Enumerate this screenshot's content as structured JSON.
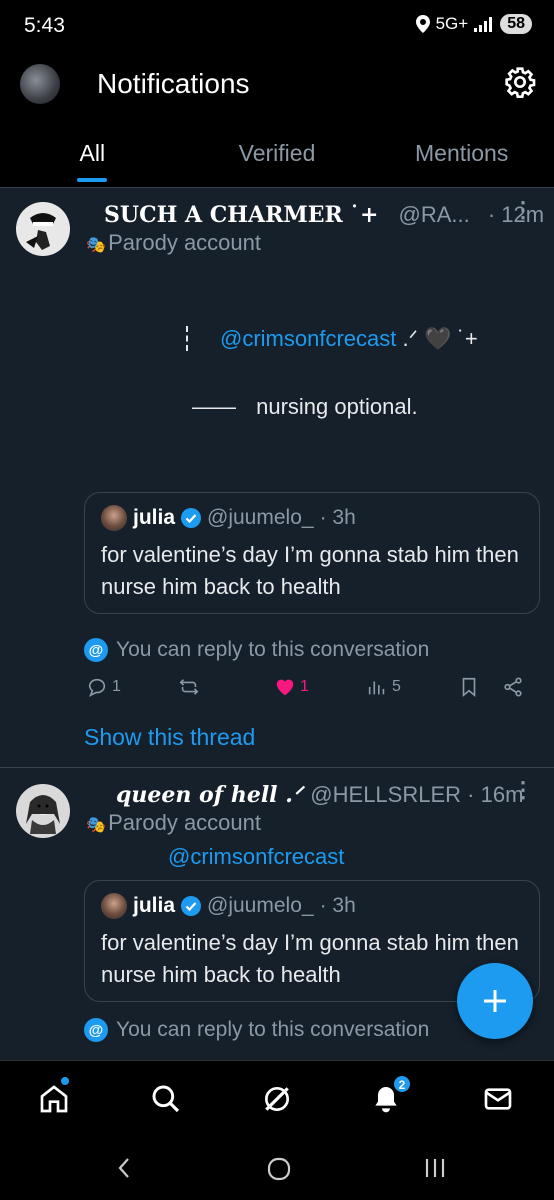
{
  "status": {
    "time": "5:43",
    "network": "5G+",
    "battery": "58"
  },
  "header": {
    "title": "Notifications"
  },
  "tabs": [
    {
      "label": "All",
      "active": true
    },
    {
      "label": "Verified",
      "active": false
    },
    {
      "label": "Mentions",
      "active": false
    }
  ],
  "posts": [
    {
      "display_name": "SUCH A CHARMER",
      "name_suffix": "˙+",
      "handle": "@RA...",
      "time": "· 12m",
      "parody_label": "Parody account",
      "body_line1_mention": "@crimsonfcrecast",
      "body_line1_suffix": ".ᐟ 🖤  ˙+",
      "body_line2_dash": "——",
      "body_line2_text": "nursing   optional.",
      "quote": {
        "name": "julia",
        "handle": "@juumelo_",
        "time": "· 3h",
        "text": "for valentine’s day I’m gonna stab him then nurse him back to health"
      },
      "reply_note": "You can reply to this conversation",
      "actions": {
        "replies": "1",
        "likes": "1",
        "views": "5"
      },
      "show_thread": "Show this thread"
    },
    {
      "display_name": "queen of hell .ᐟ",
      "handle": "@HELLSRLER",
      "time": "· 16m",
      "parody_label": "Parody account",
      "mention": "@crimsonfcrecast",
      "quote": {
        "name": "julia",
        "handle": "@juumelo_",
        "time": "· 3h",
        "text": "for valentine’s day I’m gonna stab him then nurse him back to health"
      },
      "reply_note": "You can reply to this conversation"
    }
  ],
  "nav": {
    "notification_count": "2"
  },
  "colors": {
    "accent": "#1d9bf0",
    "like": "#f91880",
    "background": "#15202b"
  }
}
